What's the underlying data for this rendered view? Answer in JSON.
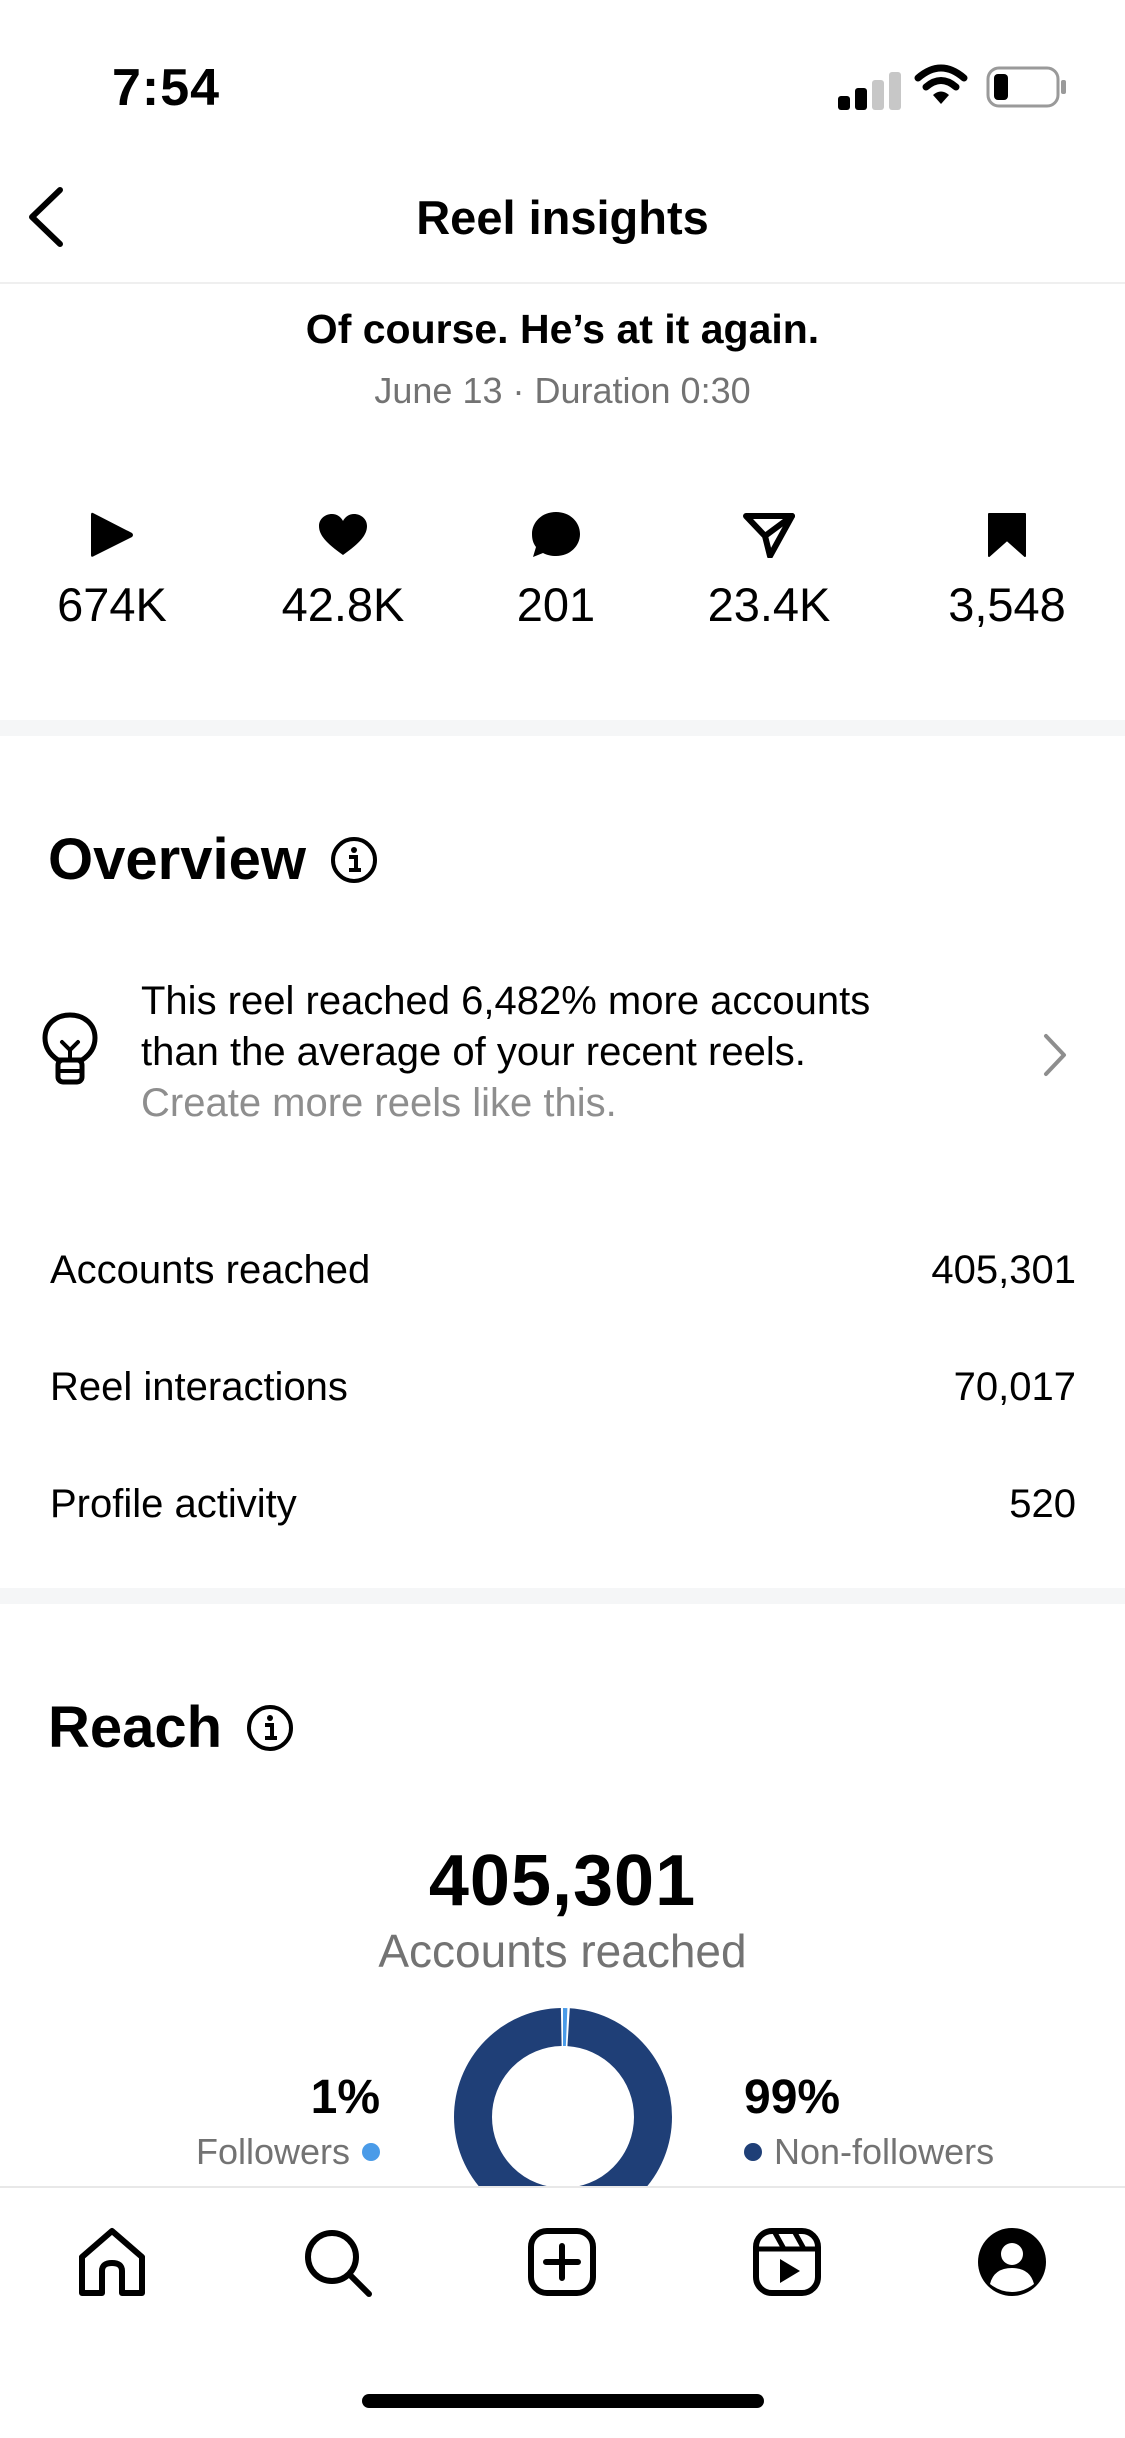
{
  "status_bar": {
    "time": "7:54"
  },
  "header": {
    "title": "Reel insights"
  },
  "reel": {
    "caption": "Of course. He’s at it again.",
    "meta": "June 13 · Duration 0:30"
  },
  "stats": [
    {
      "icon": "play-icon",
      "value": "674K"
    },
    {
      "icon": "heart-icon",
      "value": "42.8K"
    },
    {
      "icon": "comment-icon",
      "value": "201"
    },
    {
      "icon": "share-icon",
      "value": "23.4K"
    },
    {
      "icon": "bookmark-icon",
      "value": "3,548"
    }
  ],
  "overview": {
    "title": "Overview",
    "tip": {
      "line1": "This reel reached 6,482% more accounts",
      "line2": "than the average of your recent reels.",
      "cta": "Create more reels like this."
    },
    "metrics": [
      {
        "label": "Accounts reached",
        "value": "405,301"
      },
      {
        "label": "Reel interactions",
        "value": "70,017"
      },
      {
        "label": "Profile activity",
        "value": "520"
      }
    ]
  },
  "reach": {
    "title": "Reach",
    "total": "405,301",
    "subtitle": "Accounts reached",
    "followers": {
      "percent": "1%",
      "label": "Followers",
      "color": "#4a9be8"
    },
    "non_followers": {
      "percent": "99%",
      "label": "Non-followers",
      "color": "#1f3f77"
    }
  },
  "chart_data": {
    "type": "pie",
    "categories": [
      "Followers",
      "Non-followers"
    ],
    "values": [
      1,
      99
    ],
    "colors": [
      "#4a9be8",
      "#1f3f77"
    ]
  },
  "tab_bar": [
    "home-icon",
    "search-icon",
    "create-icon",
    "reels-icon",
    "profile-icon"
  ]
}
